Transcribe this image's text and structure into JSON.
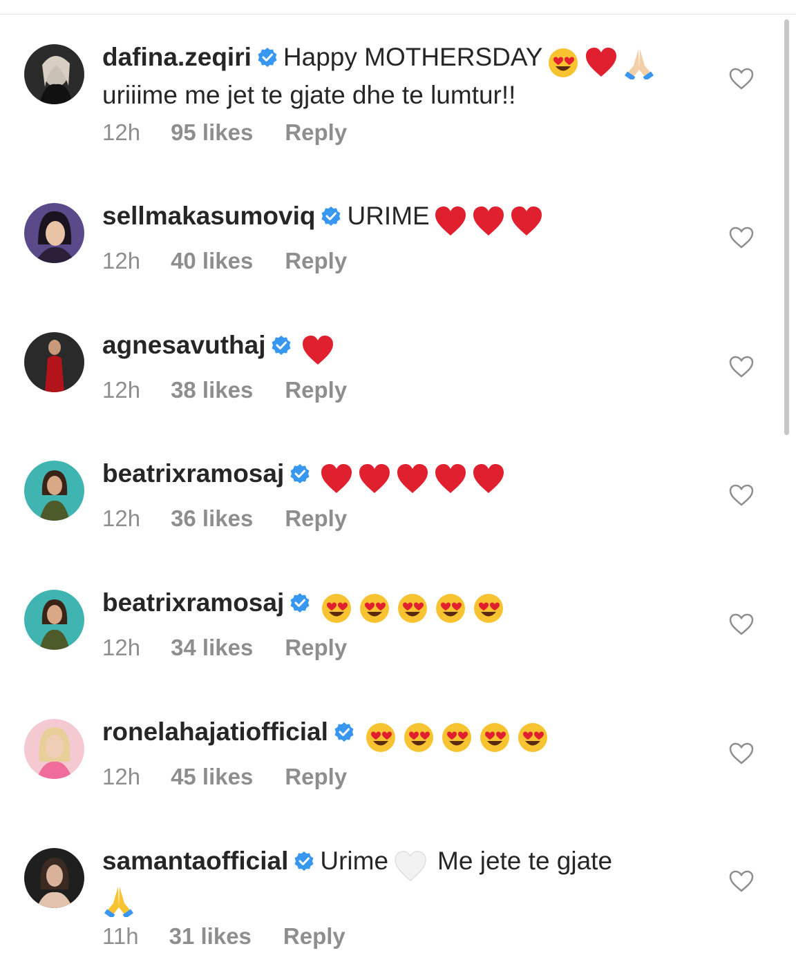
{
  "colors": {
    "verified": "#3897f0",
    "meta": "#8e8e8e",
    "text": "#262626",
    "heart": "#e0202e"
  },
  "comments": [
    {
      "username": "dafina.zeqiri",
      "text_line1": "Happy MOTHERSDAY",
      "emojis_line1": [
        "heart-eyes-emoji",
        "red-heart-emoji",
        "folded-hands-emoji"
      ],
      "text_line2": "uriiime me jet te gjate dhe te lumtur!!",
      "time": "12h",
      "likes": "95 likes",
      "reply": "Reply",
      "avatar_icon": "avatar-dark-hair"
    },
    {
      "username": "sellmakasumoviq",
      "text_line1": "URIME",
      "emojis_line1": [
        "red-heart-emoji",
        "red-heart-emoji",
        "red-heart-emoji"
      ],
      "time": "12h",
      "likes": "40 likes",
      "reply": "Reply",
      "avatar_icon": "avatar-purple"
    },
    {
      "username": "agnesavuthaj",
      "text_line1": "",
      "emojis_line1": [
        "red-heart-emoji"
      ],
      "time": "12h",
      "likes": "38 likes",
      "reply": "Reply",
      "avatar_icon": "avatar-red-dress"
    },
    {
      "username": "beatrixramosaj",
      "text_line1": "",
      "emojis_line1": [
        "red-heart-emoji",
        "red-heart-emoji",
        "red-heart-emoji",
        "red-heart-emoji",
        "red-heart-emoji"
      ],
      "time": "12h",
      "likes": "36 likes",
      "reply": "Reply",
      "avatar_icon": "avatar-teal"
    },
    {
      "username": "beatrixramosaj",
      "text_line1": "",
      "emojis_line1": [
        "heart-eyes-emoji",
        "heart-eyes-emoji",
        "heart-eyes-emoji",
        "heart-eyes-emoji",
        "heart-eyes-emoji"
      ],
      "time": "12h",
      "likes": "34 likes",
      "reply": "Reply",
      "avatar_icon": "avatar-teal"
    },
    {
      "username": "ronelahajatiofficial",
      "text_line1": "",
      "emojis_line1": [
        "heart-eyes-emoji",
        "heart-eyes-emoji",
        "heart-eyes-emoji",
        "heart-eyes-emoji",
        "heart-eyes-emoji"
      ],
      "time": "12h",
      "likes": "45 likes",
      "reply": "Reply",
      "avatar_icon": "avatar-pink"
    },
    {
      "username": "samantaofficial",
      "text_line1": "Urime",
      "emojis_mid": [
        "white-heart-emoji"
      ],
      "text_line1b": "Me jete te gjate",
      "emojis_line2": [
        "folded-hands-emoji"
      ],
      "time": "11h",
      "likes": "31 likes",
      "reply": "Reply",
      "avatar_icon": "avatar-dark"
    }
  ]
}
